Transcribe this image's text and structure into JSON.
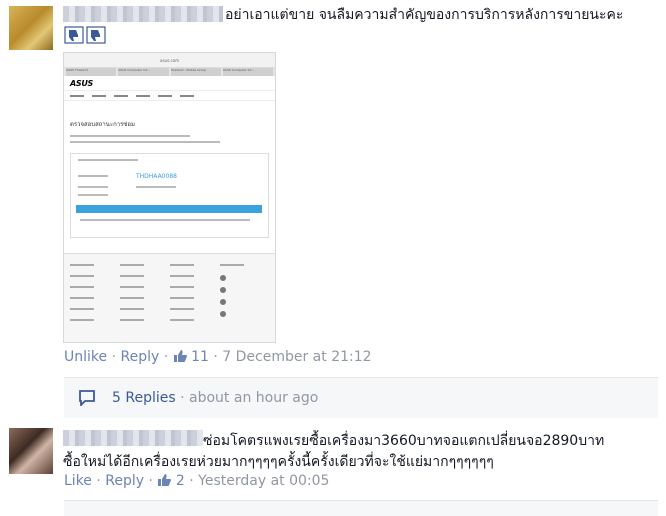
{
  "comments": [
    {
      "text": "อย่าเอาแต่ขาย จนลืมความสำคัญของการบริการหลังการขายนะคะ",
      "actions": {
        "like": "Unlike",
        "reply": "Reply",
        "likes": "11",
        "time": "7 December at 21:12"
      },
      "attachment": {
        "browser_url": "asus.com",
        "tabs": [
          "ASUS Thailand",
          "ASUS Computer Int...",
          "Thailand - Mobile Group",
          "ASUS Computer Int..."
        ],
        "brand": "ASUS",
        "page_title": "ตรวจสอบสถานะการซ่อม",
        "rma_number": "THDHAA0088"
      },
      "replies": {
        "label": "5 Replies",
        "time": "about an hour ago"
      }
    },
    {
      "text_line1": "ซ่อมโคตรแพงเรยซื้อเครื่องมา3660บาทจอแตกเปลี่ยนจอ2890บาท",
      "text_line2": "ซื้อใหม่ได้อีกเครื่องเรยห่วยมากๆๆๆๆครั้งนี้ครั้งเดียวที่จะใช้แย่มากๆๆๆๆๆๆ",
      "actions": {
        "like": "Like",
        "reply": "Reply",
        "likes": "2",
        "time": "Yesterday at 00:05"
      }
    }
  ],
  "colors": {
    "link": "#6d84b4",
    "meta": "#9197a3",
    "reply_link": "#3b5998",
    "accent": "#3aa3de"
  }
}
